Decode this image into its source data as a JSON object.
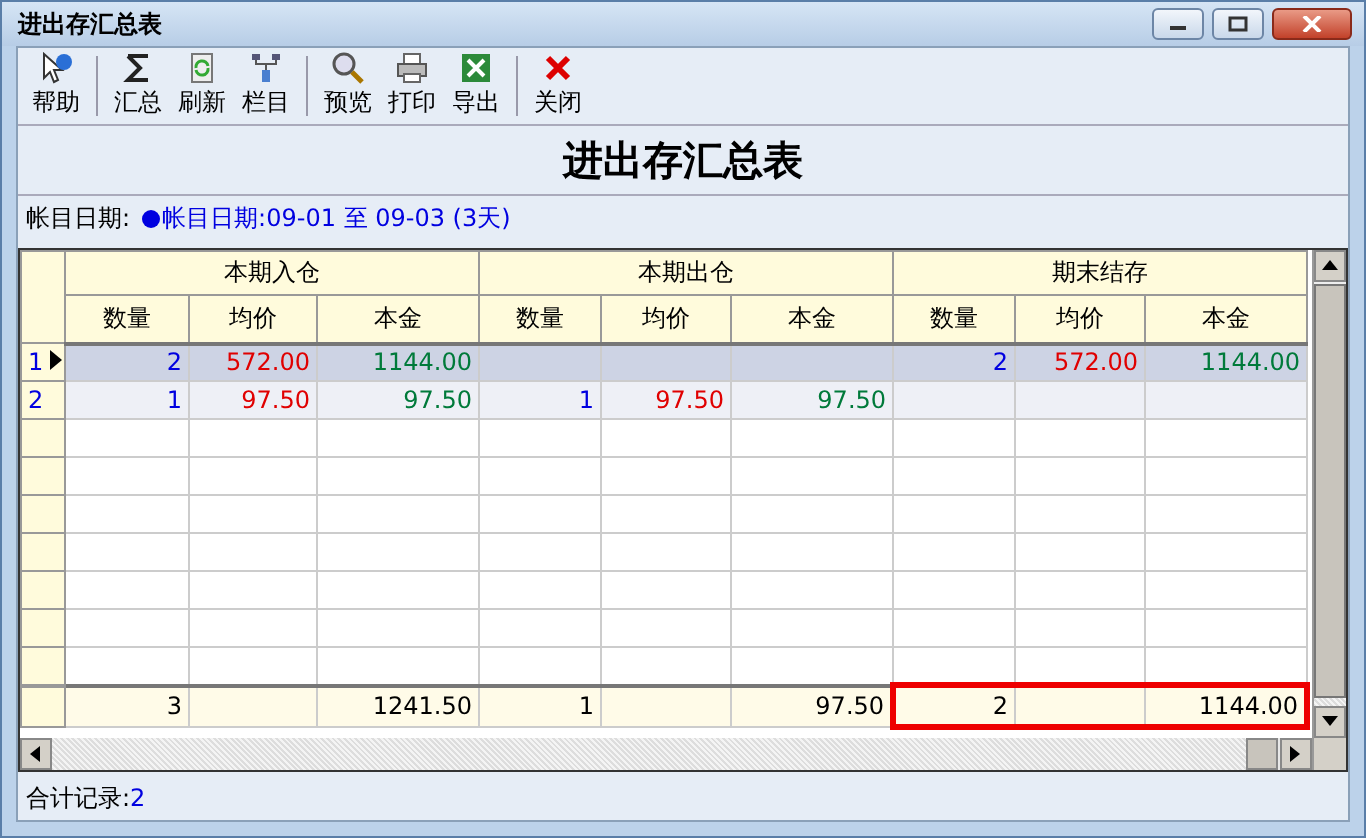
{
  "window": {
    "title": "进出存汇总表"
  },
  "toolbar": [
    {
      "label": "帮助",
      "kind": "help"
    },
    {
      "label": "汇总",
      "kind": "sum"
    },
    {
      "label": "刷新",
      "kind": "refresh"
    },
    {
      "label": "栏目",
      "kind": "columns"
    },
    {
      "label": "预览",
      "kind": "preview"
    },
    {
      "label": "打印",
      "kind": "print"
    },
    {
      "label": "导出",
      "kind": "export"
    },
    {
      "label": "关闭",
      "kind": "close"
    }
  ],
  "heading": "进出存汇总表",
  "period": {
    "label": "帐目日期:",
    "value": "帐目日期:09-01 至 09-03 (3天)"
  },
  "table": {
    "groups": [
      {
        "label": "本期入仓",
        "columns": [
          "数量",
          "均价",
          "本金"
        ]
      },
      {
        "label": "本期出仓",
        "columns": [
          "数量",
          "均价",
          "本金"
        ]
      },
      {
        "label": "期末结存",
        "columns": [
          "数量",
          "均价",
          "本金"
        ]
      }
    ],
    "rows": [
      {
        "number": "1",
        "selected": true,
        "cells": [
          "2",
          "572.00",
          "1144.00",
          "",
          "",
          "",
          "2",
          "572.00",
          "1144.00"
        ]
      },
      {
        "number": "2",
        "selected": false,
        "cells": [
          "1",
          "97.50",
          "97.50",
          "1",
          "97.50",
          "97.50",
          "",
          "",
          ""
        ]
      }
    ],
    "totals": [
      {
        "outlined": false,
        "cells": [
          "3",
          "",
          "1241.50"
        ]
      },
      {
        "outlined": false,
        "cells": [
          "1",
          "",
          "97.50"
        ]
      },
      {
        "outlined": true,
        "cells": [
          "2",
          "",
          "1144.00"
        ]
      }
    ]
  },
  "status_bar": {
    "label": "合计记录:",
    "count": "2"
  }
}
